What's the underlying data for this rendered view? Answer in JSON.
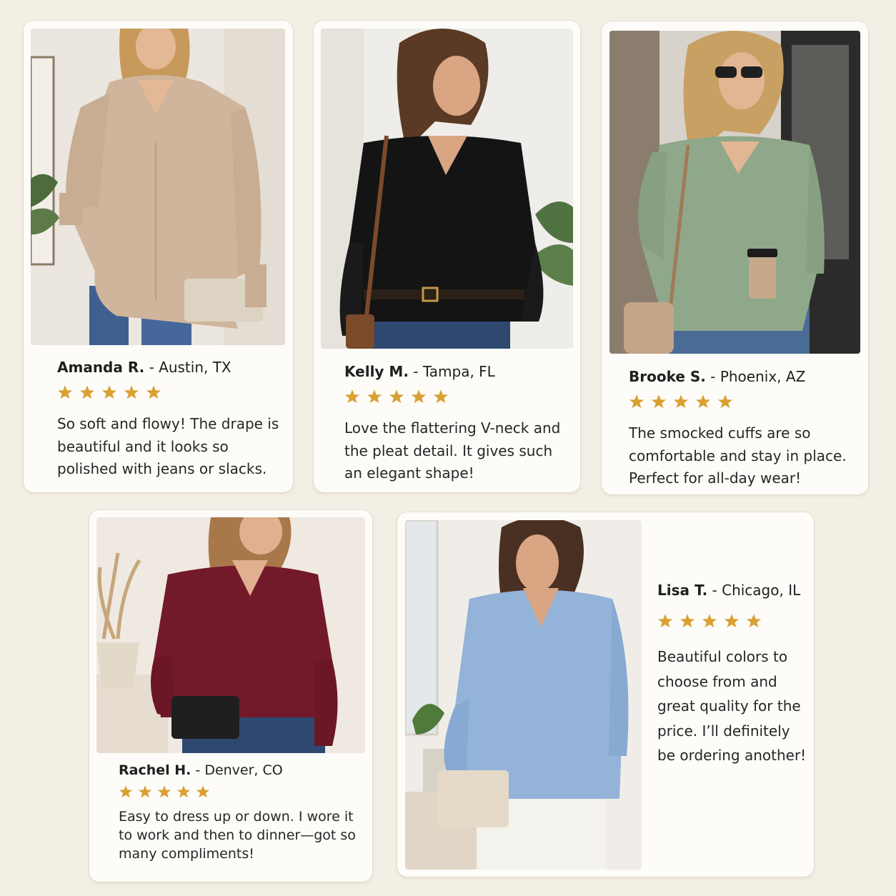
{
  "colors": {
    "background": "#f4efe4",
    "card": "#fdfcf8",
    "star": "#d9a032"
  },
  "reviews": [
    {
      "name": "Amanda R.",
      "location": "- Austin, TX",
      "rating": 5,
      "quote": "So soft and flowy! The drape is beautiful and it looks so polished with jeans or slacks.",
      "photo_alt": "Woman wearing a beige long-sleeve V-neck blouse with jeans, holding a clutch",
      "blouse_color": "#cfb59b"
    },
    {
      "name": "Kelly M.",
      "location": "- Tampa, FL",
      "rating": 5,
      "quote": "Love the flattering V-neck and the pleat detail. It gives such an elegant shape!",
      "photo_alt": "Woman wearing a black long-sleeve V-neck blouse with jeans and a brown crossbody bag",
      "blouse_color": "#141414"
    },
    {
      "name": "Brooke S.",
      "location": "- Phoenix, AZ",
      "rating": 5,
      "quote": "The smocked cuffs are so comfortable and stay in place. Perfect for all-day wear!",
      "photo_alt": "Woman in sunglasses wearing a sage green V-neck blouse, holding a coffee cup",
      "blouse_color": "#8fa88a"
    },
    {
      "name": "Rachel H.",
      "location": "- Denver, CO",
      "rating": 5,
      "quote": "Easy to dress up or down. I wore it to work and then to dinner—got so many compliments!",
      "photo_alt": "Woman wearing a burgundy V-neck blouse with jeans, holding a black clutch",
      "blouse_color": "#731a2a"
    },
    {
      "name": "Lisa T.",
      "location": "- Chicago, IL",
      "rating": 5,
      "quote": "Beautiful colors to choose from and great quality for the price. I’ll definitely be ordering another!",
      "photo_alt": "Woman wearing a light blue V-neck blouse with white pants, holding a cream clutch",
      "blouse_color": "#93b3d9"
    }
  ]
}
